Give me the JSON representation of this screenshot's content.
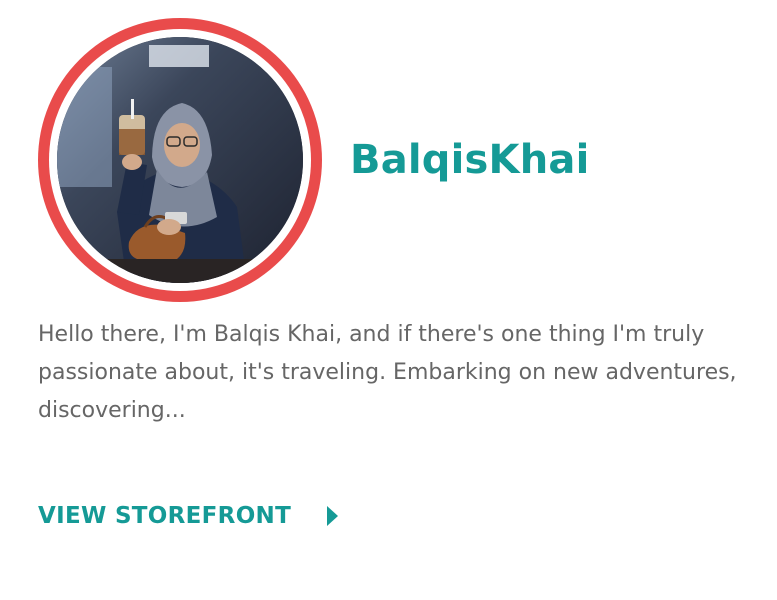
{
  "profile": {
    "username": "BalqisKhai",
    "bio": "Hello there, I'm Balqis Khai, and if there's one thing I'm truly passionate about, it's traveling. Embarking on new adventures, discovering...",
    "avatar_alt": "Profile photo",
    "cta_label": "VIEW STOREFRONT"
  },
  "icons": {
    "cta_icon": "caret-right-icon"
  },
  "colors": {
    "accent": "#159a96",
    "ring": "#e94b4b",
    "body_text": "#666666",
    "background": "#ffffff"
  }
}
